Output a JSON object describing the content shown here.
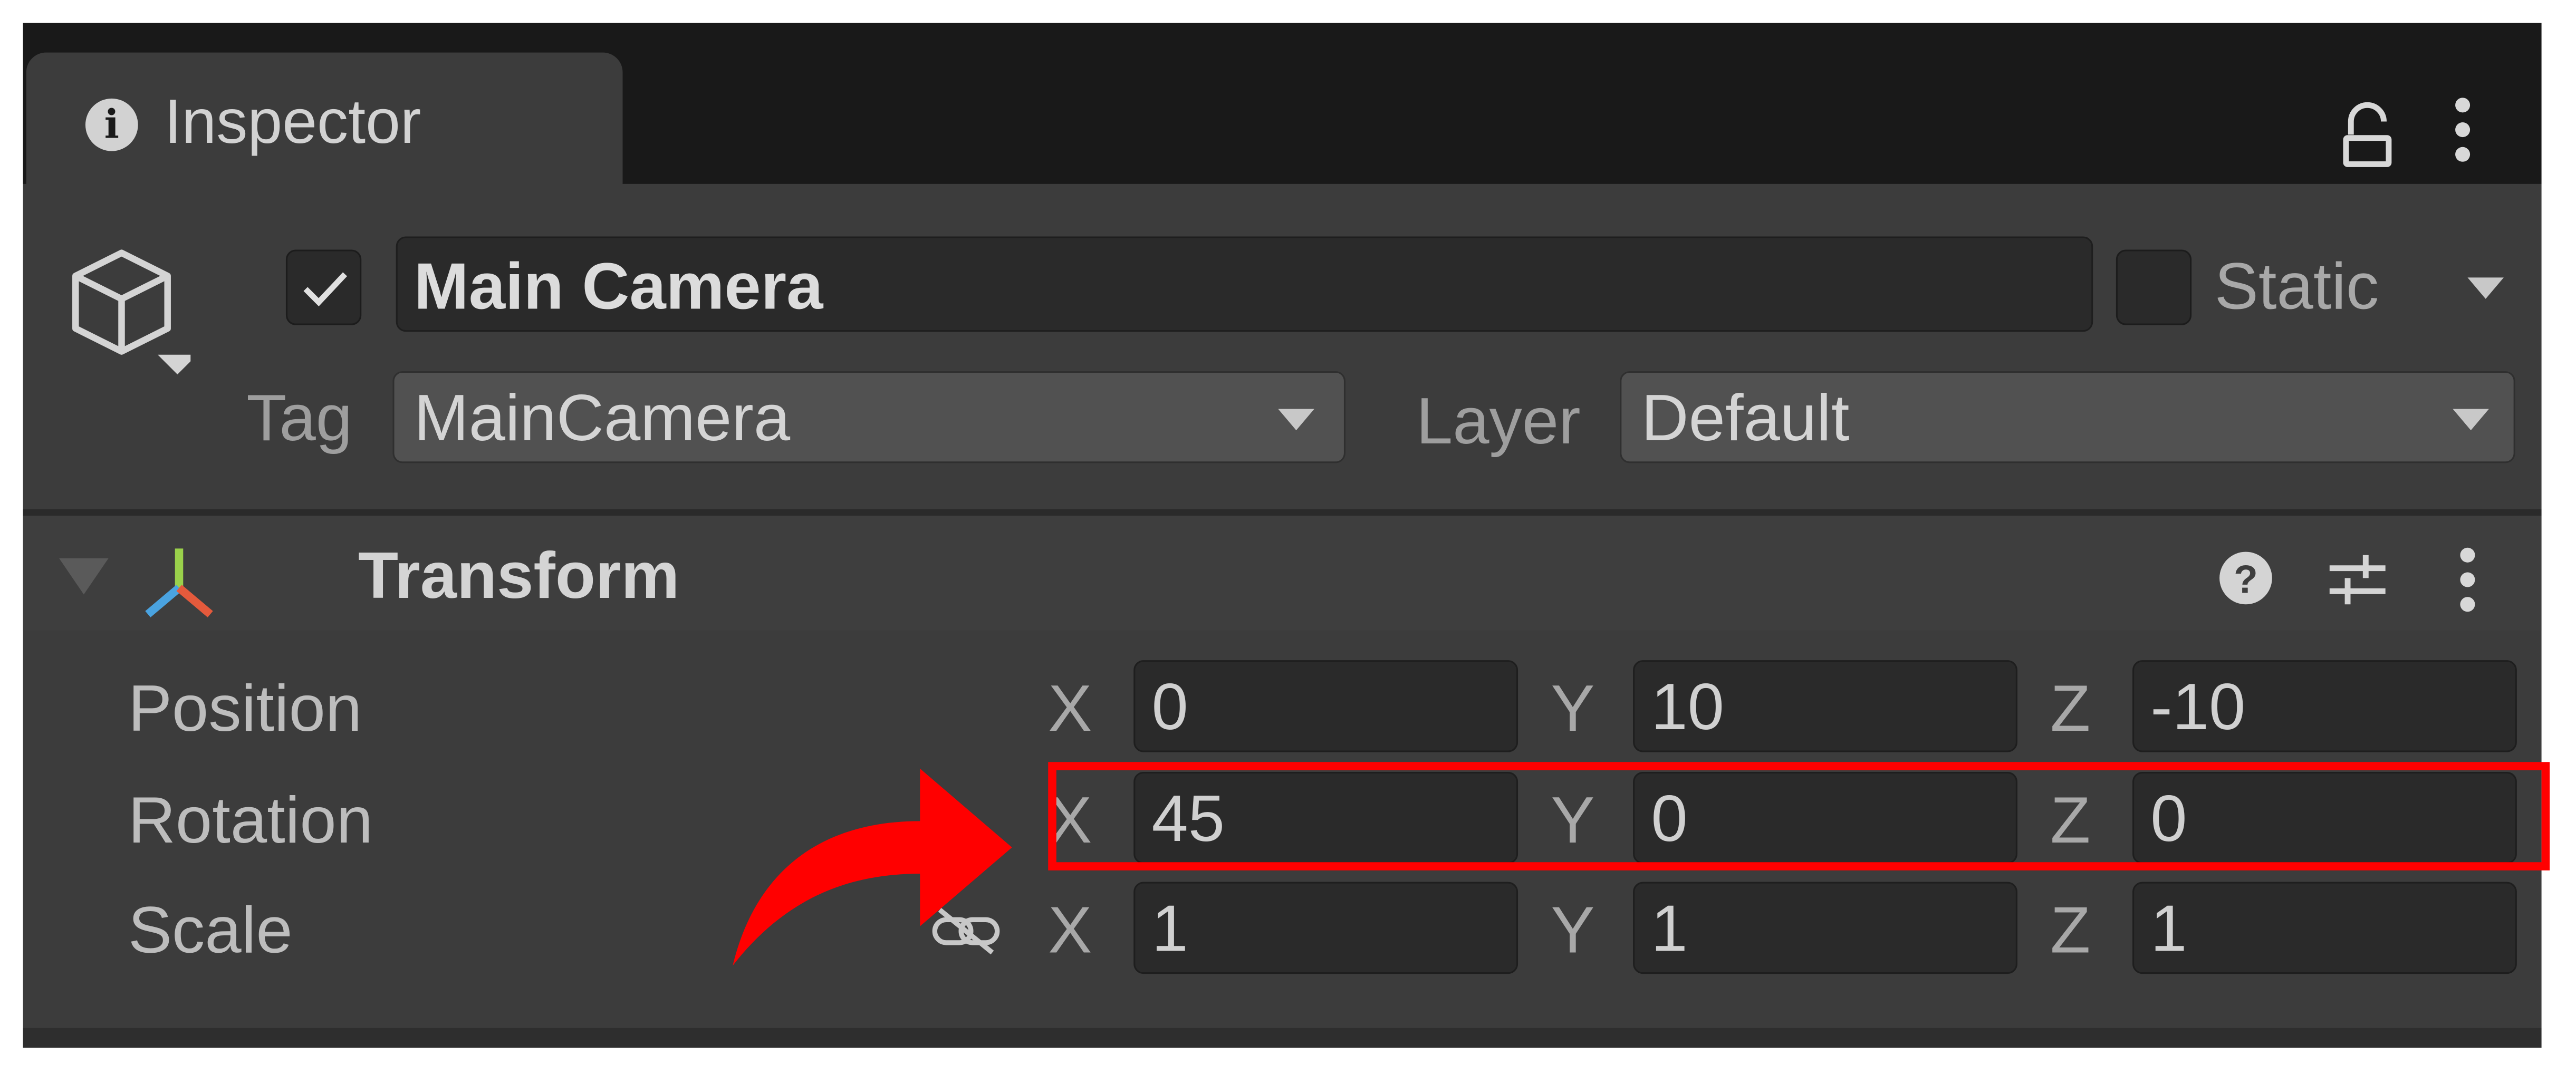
{
  "inspector": {
    "tab_title": "Inspector",
    "gameobject": {
      "active": true,
      "name": "Main Camera",
      "static_label": "Static",
      "static_checked": false,
      "tag_label": "Tag",
      "tag_value": "MainCamera",
      "layer_label": "Layer",
      "layer_value": "Default"
    },
    "transform": {
      "title": "Transform",
      "rows": [
        {
          "label": "Position",
          "x": "0",
          "y": "10",
          "z": "-10"
        },
        {
          "label": "Rotation",
          "x": "45",
          "y": "0",
          "z": "0"
        },
        {
          "label": "Scale",
          "x": "1",
          "y": "1",
          "z": "1"
        }
      ],
      "axis_labels": [
        "X",
        "Y",
        "Z"
      ]
    }
  },
  "annotation": {
    "highlight_color": "#ff0000",
    "highlighted_row": "Rotation"
  },
  "colors": {
    "panel_bg": "#3c3c3c",
    "tabbar_bg": "#191919",
    "field_bg": "#2a2a2a",
    "dropdown_bg": "#515151",
    "text": "#c4c4c4",
    "accent": "#ff0000"
  }
}
